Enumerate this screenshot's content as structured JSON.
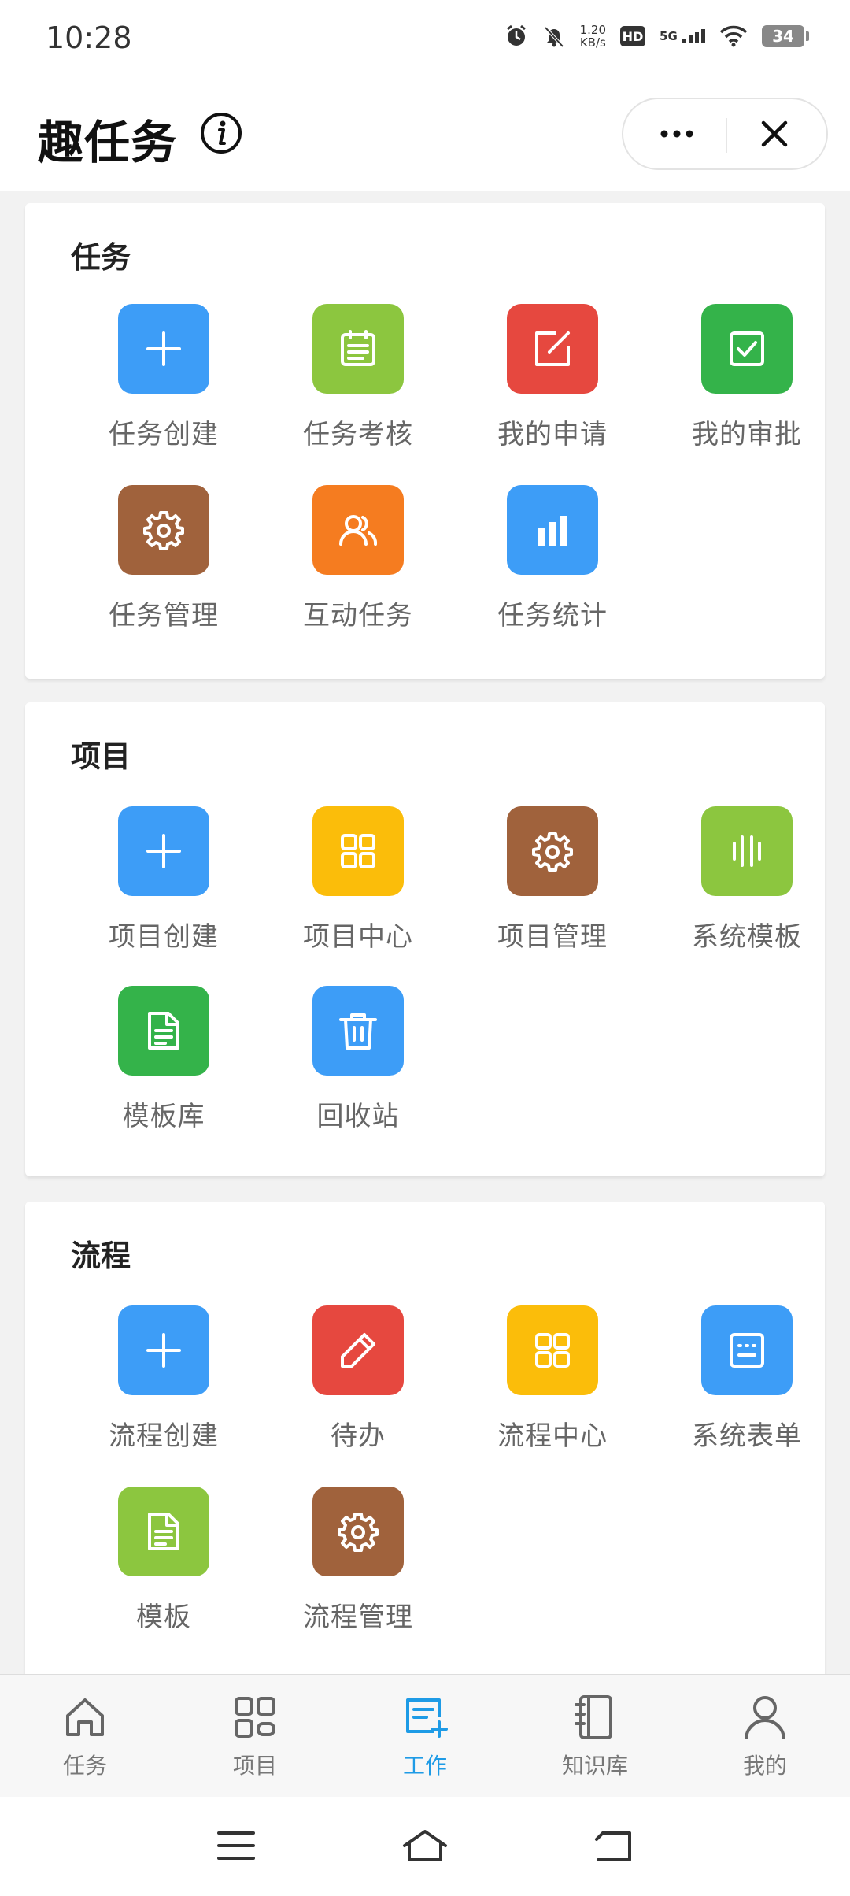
{
  "status_bar": {
    "time": "10:28",
    "net_speed_value": "1.20",
    "net_speed_unit": "KB/s",
    "hd": "HD",
    "network": "5G",
    "battery": "34"
  },
  "header": {
    "title": "趣任务",
    "more_icon": "more-dots-icon",
    "close_icon": "close-icon"
  },
  "sections": [
    {
      "title": "任务",
      "items": [
        {
          "label": "任务创建",
          "icon": "plus-icon",
          "color": "#3d9df7"
        },
        {
          "label": "任务考核",
          "icon": "clipboard-icon",
          "color": "#8cc63f"
        },
        {
          "label": "我的申请",
          "icon": "edit-square-icon",
          "color": "#e6483f"
        },
        {
          "label": "我的审批",
          "icon": "check-square-icon",
          "color": "#34b34a"
        },
        {
          "label": "任务管理",
          "icon": "gear-icon",
          "color": "#a0623c"
        },
        {
          "label": "互动任务",
          "icon": "users-icon",
          "color": "#f57c20"
        },
        {
          "label": "任务统计",
          "icon": "bar-chart-icon",
          "color": "#3d9df7"
        }
      ]
    },
    {
      "title": "项目",
      "items": [
        {
          "label": "项目创建",
          "icon": "plus-icon",
          "color": "#3d9df7"
        },
        {
          "label": "项目中心",
          "icon": "grid-icon",
          "color": "#fbbd0a"
        },
        {
          "label": "项目管理",
          "icon": "gear-icon",
          "color": "#a0623c"
        },
        {
          "label": "系统模板",
          "icon": "vertical-lines-icon",
          "color": "#8cc63f"
        },
        {
          "label": "模板库",
          "icon": "document-icon",
          "color": "#34b34a"
        },
        {
          "label": "回收站",
          "icon": "trash-icon",
          "color": "#3d9df7"
        }
      ]
    },
    {
      "title": "流程",
      "items": [
        {
          "label": "流程创建",
          "icon": "plus-icon",
          "color": "#3d9df7"
        },
        {
          "label": "待办",
          "icon": "pencil-icon",
          "color": "#e6483f"
        },
        {
          "label": "流程中心",
          "icon": "grid-icon",
          "color": "#fbbd0a"
        },
        {
          "label": "系统表单",
          "icon": "form-icon",
          "color": "#3d9df7"
        },
        {
          "label": "模板",
          "icon": "document-icon",
          "color": "#8cc63f"
        },
        {
          "label": "流程管理",
          "icon": "gear-icon",
          "color": "#a0623c"
        }
      ]
    }
  ],
  "tab_bar": {
    "active_color": "#1e9be6",
    "tabs": [
      {
        "label": "任务",
        "icon": "home-icon"
      },
      {
        "label": "项目",
        "icon": "grid-icon"
      },
      {
        "label": "工作",
        "icon": "work-edit-icon",
        "active": true
      },
      {
        "label": "知识库",
        "icon": "notebook-icon"
      },
      {
        "label": "我的",
        "icon": "user-icon"
      }
    ]
  },
  "nav_bar": {
    "buttons": [
      "menu-icon",
      "home-icon",
      "back-icon"
    ]
  }
}
